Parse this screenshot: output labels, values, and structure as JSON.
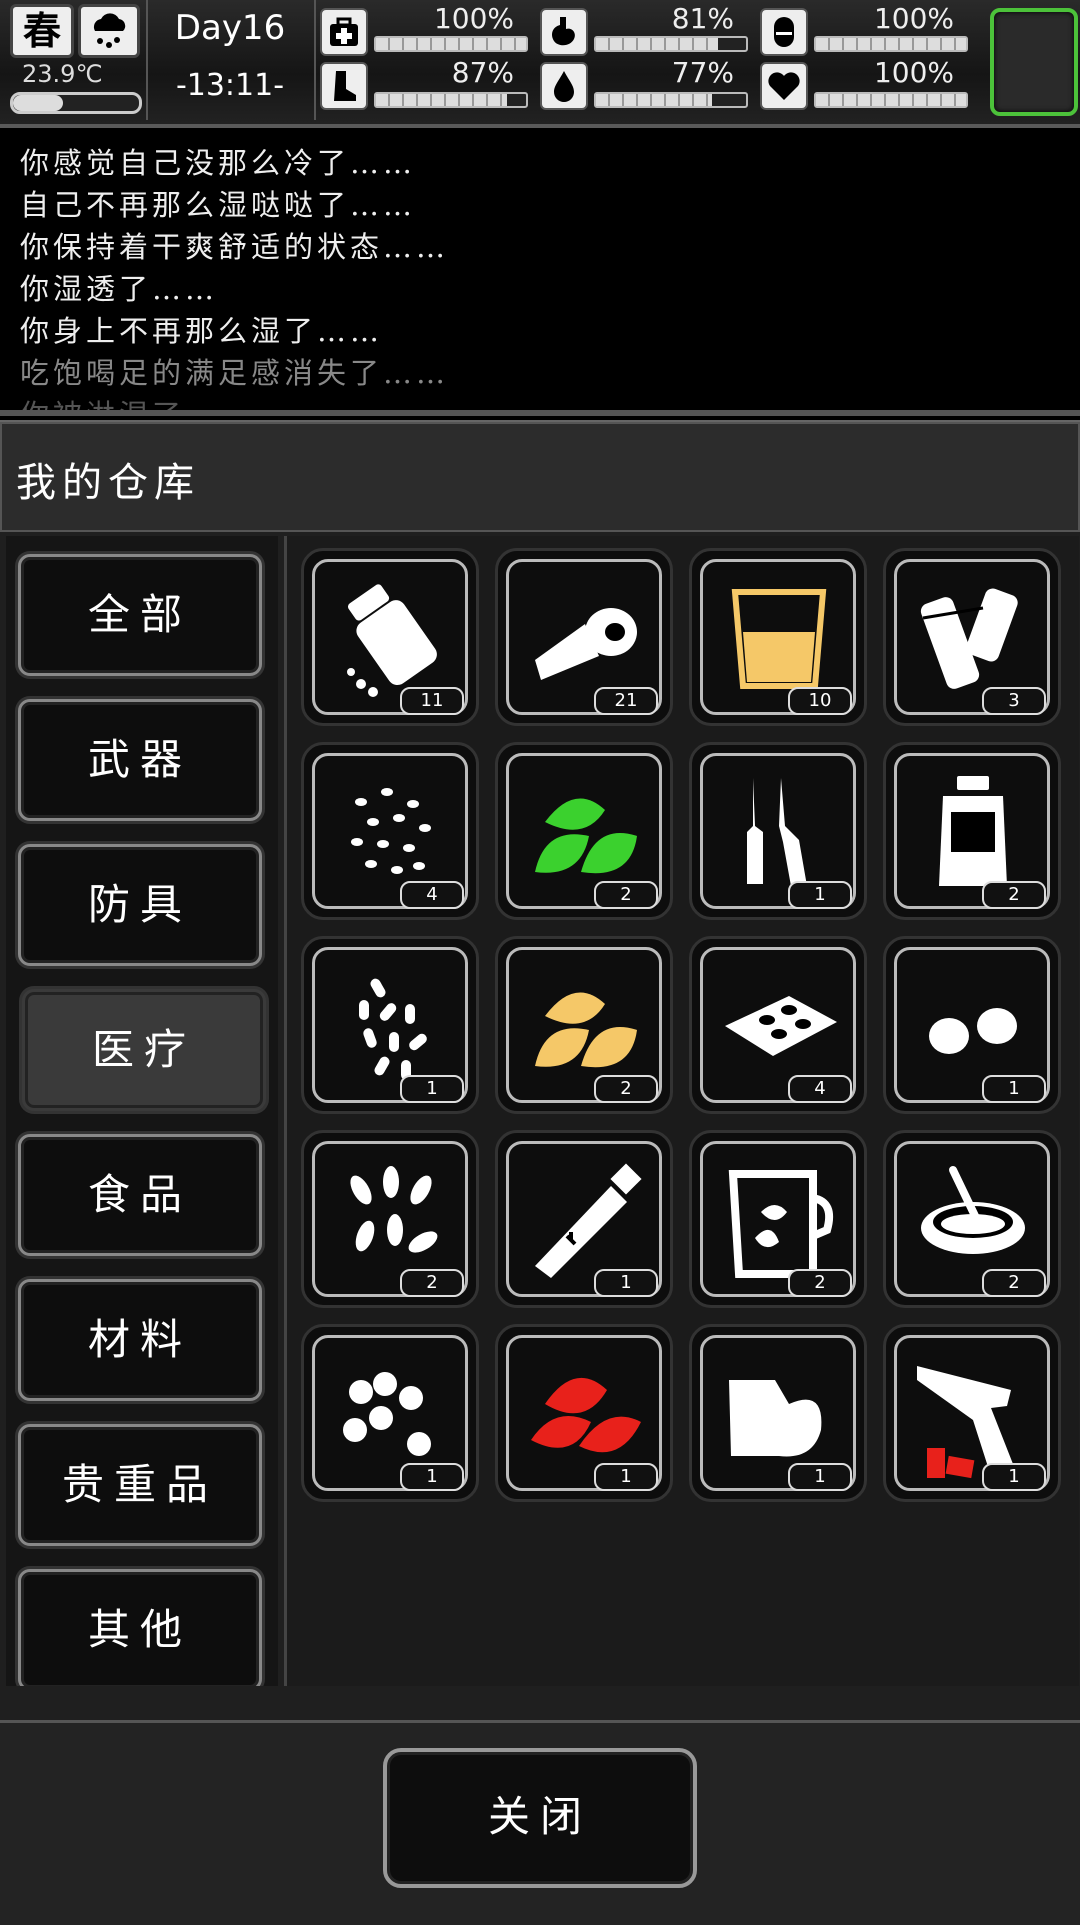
{
  "hud": {
    "season": "春",
    "temperature": "23.9℃",
    "temperature_level": 0.4,
    "day": "Day16",
    "time": "-13:11-",
    "stats": [
      {
        "icon": "medkit-icon",
        "value": "100%",
        "level": 1.0
      },
      {
        "icon": "stomach-icon",
        "value": "81%",
        "level": 0.81
      },
      {
        "icon": "bladder-icon",
        "value": "100%",
        "level": 1.0
      },
      {
        "icon": "boot-icon",
        "value": "87%",
        "level": 0.87
      },
      {
        "icon": "water-drop-icon",
        "value": "77%",
        "level": 0.77
      },
      {
        "icon": "heart-icon",
        "value": "100%",
        "level": 1.0
      }
    ],
    "equip_slot_color": "#4cc23a"
  },
  "log": [
    "你感觉自己没那么冷了……",
    "自己不再那么湿哒哒了……",
    "你保持着干爽舒适的状态……",
    "你湿透了……",
    "你身上不再那么湿了……",
    "吃饱喝足的满足感消失了……",
    "你被淋湿了"
  ],
  "panel": {
    "title": "我的仓库",
    "categories": [
      "全部",
      "武器",
      "防具",
      "医疗",
      "食品",
      "材料",
      "贵重品",
      "其他"
    ],
    "active_category": "医疗",
    "items": [
      {
        "icon": "pill-bottle-icon",
        "count": "11"
      },
      {
        "icon": "bandage-roll-icon",
        "count": "21"
      },
      {
        "icon": "glass-of-liquid-icon",
        "count": "10"
      },
      {
        "icon": "splint-icon",
        "count": "3"
      },
      {
        "icon": "seeds-icon",
        "count": "4"
      },
      {
        "icon": "green-herb-icon",
        "count": "2"
      },
      {
        "icon": "ampoule-icon",
        "count": "1"
      },
      {
        "icon": "medicine-jar-icon",
        "count": "2"
      },
      {
        "icon": "capsules-icon",
        "count": "1"
      },
      {
        "icon": "yellow-herb-icon",
        "count": "2"
      },
      {
        "icon": "pill-tray-icon",
        "count": "4"
      },
      {
        "icon": "nuts-icon",
        "count": "1"
      },
      {
        "icon": "petals-icon",
        "count": "2"
      },
      {
        "icon": "ointment-tube-icon",
        "count": "1"
      },
      {
        "icon": "herbal-tea-icon",
        "count": "2"
      },
      {
        "icon": "porridge-bowl-icon",
        "count": "2"
      },
      {
        "icon": "berries-icon",
        "count": "1"
      },
      {
        "icon": "red-herb-icon",
        "count": "1"
      },
      {
        "icon": "cast-icon",
        "count": "1"
      },
      {
        "icon": "flare-gun-icon",
        "count": "1"
      }
    ],
    "close_label": "关闭"
  }
}
